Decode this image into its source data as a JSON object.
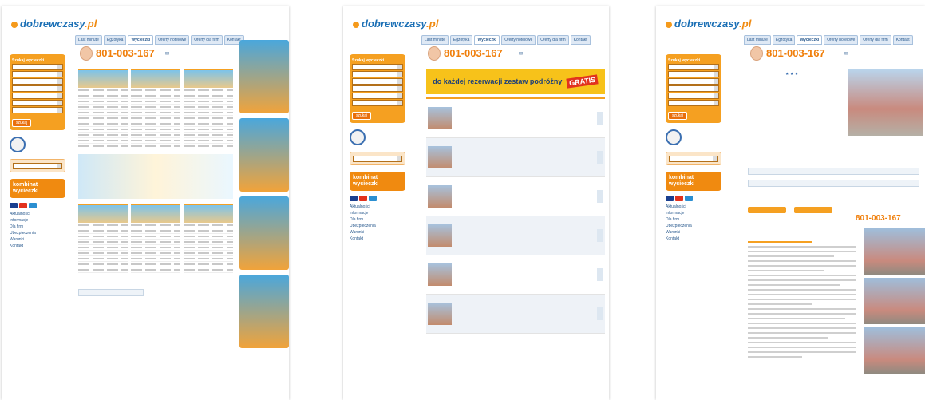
{
  "site": {
    "logo": "dobrewczasy",
    "logo_tld": ".pl"
  },
  "phone": {
    "number": "801-003-167"
  },
  "tabs": [
    "Last minute",
    "Egzotyka",
    "Wycieczki",
    "Oferty hotelowe",
    "Oferty dla firm",
    "Kontakt"
  ],
  "sidebar": {
    "search_title": "Szukaj wycieczki",
    "search_button": "szukaj",
    "combo_label": "kombinat wycieczki",
    "menu": [
      "Aktualności",
      "Informacje",
      "Dla firm",
      "Ubezpieczenia",
      "Warunki",
      "Kontakt"
    ]
  },
  "screen2": {
    "promo_text": "do każdej rezerwacji zestaw podróżny",
    "promo_badge": "GRATIS"
  },
  "screen3": {
    "phone_big": "801-003-167"
  }
}
